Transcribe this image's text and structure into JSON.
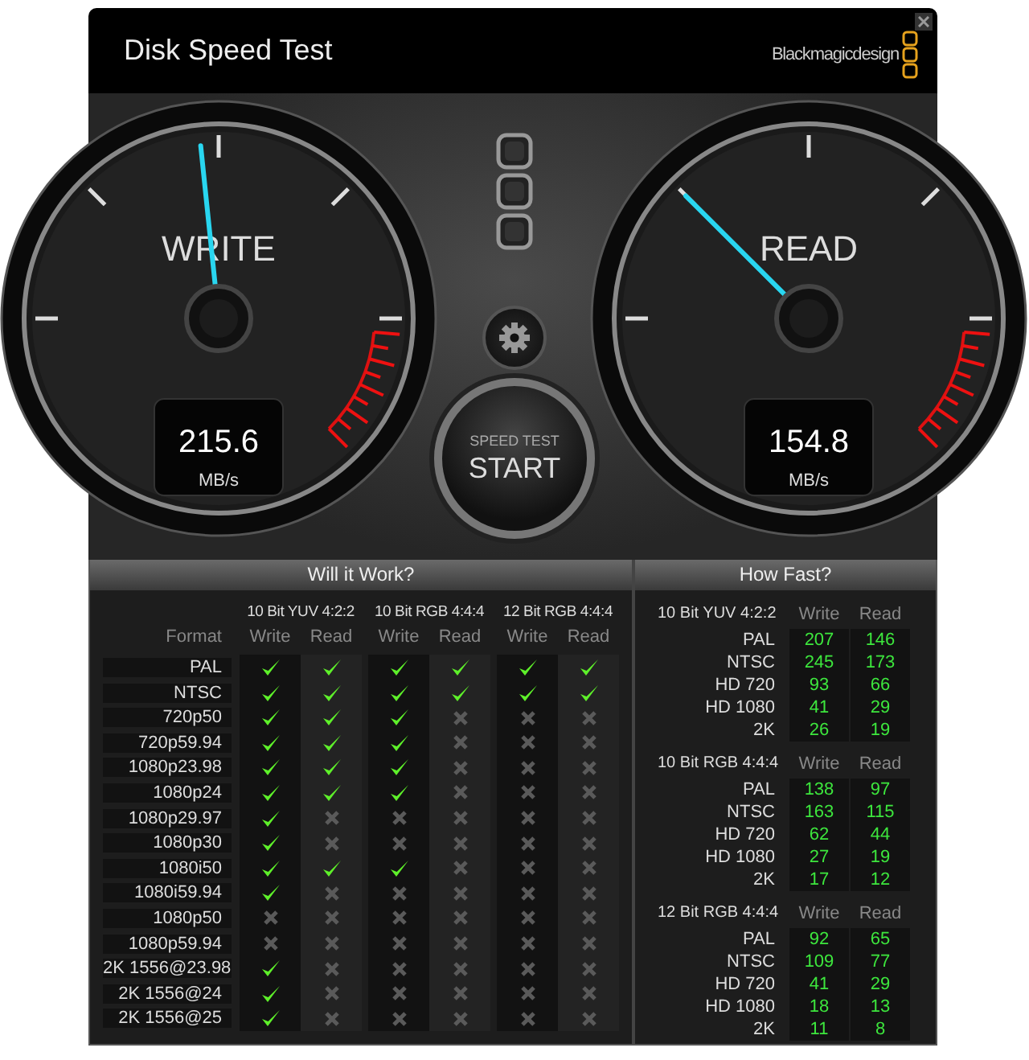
{
  "window": {
    "title": "Disk Speed Test",
    "brand": "Blackmagicdesign"
  },
  "gauges": [
    {
      "label": "WRITE",
      "reading": "215.6",
      "unit": "MB/s",
      "level": 0.478
    },
    {
      "label": "READ",
      "reading": "154.8",
      "unit": "MB/s",
      "level": 0.333
    }
  ],
  "start_button": {
    "caption": "SPEED TEST",
    "label": "START"
  },
  "will_it_work": {
    "title": "Will it Work?",
    "format_header": "Format",
    "groups": [
      {
        "name": "10 Bit YUV 4:2:2",
        "columns": [
          "Write",
          "Read"
        ]
      },
      {
        "name": "10 Bit RGB 4:4:4",
        "columns": [
          "Write",
          "Read"
        ]
      },
      {
        "name": "12 Bit RGB 4:4:4",
        "columns": [
          "Write",
          "Read"
        ]
      }
    ],
    "rows": [
      {
        "format": "PAL",
        "results": [
          {
            "works": true
          },
          {
            "works": true
          },
          {
            "works": true
          },
          {
            "works": true
          },
          {
            "works": true
          },
          {
            "works": true
          }
        ]
      },
      {
        "format": "NTSC",
        "results": [
          {
            "works": true
          },
          {
            "works": true
          },
          {
            "works": true
          },
          {
            "works": true
          },
          {
            "works": true
          },
          {
            "works": true
          }
        ]
      },
      {
        "format": "720p50",
        "results": [
          {
            "works": true
          },
          {
            "works": true
          },
          {
            "works": true
          },
          {
            "works": false
          },
          {
            "works": false
          },
          {
            "works": false
          }
        ]
      },
      {
        "format": "720p59.94",
        "results": [
          {
            "works": true
          },
          {
            "works": true
          },
          {
            "works": true
          },
          {
            "works": false
          },
          {
            "works": false
          },
          {
            "works": false
          }
        ]
      },
      {
        "format": "1080p23.98",
        "results": [
          {
            "works": true
          },
          {
            "works": true
          },
          {
            "works": true
          },
          {
            "works": false
          },
          {
            "works": false
          },
          {
            "works": false
          }
        ]
      },
      {
        "format": "1080p24",
        "results": [
          {
            "works": true
          },
          {
            "works": true
          },
          {
            "works": true
          },
          {
            "works": false
          },
          {
            "works": false
          },
          {
            "works": false
          }
        ]
      },
      {
        "format": "1080p29.97",
        "results": [
          {
            "works": true
          },
          {
            "works": false
          },
          {
            "works": false
          },
          {
            "works": false
          },
          {
            "works": false
          },
          {
            "works": false
          }
        ]
      },
      {
        "format": "1080p30",
        "results": [
          {
            "works": true
          },
          {
            "works": false
          },
          {
            "works": false
          },
          {
            "works": false
          },
          {
            "works": false
          },
          {
            "works": false
          }
        ]
      },
      {
        "format": "1080i50",
        "results": [
          {
            "works": true
          },
          {
            "works": true
          },
          {
            "works": true
          },
          {
            "works": false
          },
          {
            "works": false
          },
          {
            "works": false
          }
        ]
      },
      {
        "format": "1080i59.94",
        "results": [
          {
            "works": true
          },
          {
            "works": false
          },
          {
            "works": false
          },
          {
            "works": false
          },
          {
            "works": false
          },
          {
            "works": false
          }
        ]
      },
      {
        "format": "1080p50",
        "results": [
          {
            "works": false
          },
          {
            "works": false
          },
          {
            "works": false
          },
          {
            "works": false
          },
          {
            "works": false
          },
          {
            "works": false
          }
        ]
      },
      {
        "format": "1080p59.94",
        "results": [
          {
            "works": false
          },
          {
            "works": false
          },
          {
            "works": false
          },
          {
            "works": false
          },
          {
            "works": false
          },
          {
            "works": false
          }
        ]
      },
      {
        "format": "2K 1556@23.98",
        "results": [
          {
            "works": true
          },
          {
            "works": false
          },
          {
            "works": false
          },
          {
            "works": false
          },
          {
            "works": false
          },
          {
            "works": false
          }
        ]
      },
      {
        "format": "2K 1556@24",
        "results": [
          {
            "works": true
          },
          {
            "works": false
          },
          {
            "works": false
          },
          {
            "works": false
          },
          {
            "works": false
          },
          {
            "works": false
          }
        ]
      },
      {
        "format": "2K 1556@25",
        "results": [
          {
            "works": true
          },
          {
            "works": false
          },
          {
            "works": false
          },
          {
            "works": false
          },
          {
            "works": false
          },
          {
            "works": false
          }
        ]
      }
    ]
  },
  "how_fast": {
    "title": "How Fast?",
    "sections": [
      {
        "name": "10 Bit YUV 4:2:2",
        "columns": [
          "Write",
          "Read"
        ],
        "rows": [
          {
            "format": "PAL",
            "write": "207",
            "read": "146"
          },
          {
            "format": "NTSC",
            "write": "245",
            "read": "173"
          },
          {
            "format": "HD 720",
            "write": "93",
            "read": "66"
          },
          {
            "format": "HD 1080",
            "write": "41",
            "read": "29"
          },
          {
            "format": "2K",
            "write": "26",
            "read": "19"
          }
        ]
      },
      {
        "name": "10 Bit RGB 4:4:4",
        "columns": [
          "Write",
          "Read"
        ],
        "rows": [
          {
            "format": "PAL",
            "write": "138",
            "read": "97"
          },
          {
            "format": "NTSC",
            "write": "163",
            "read": "115"
          },
          {
            "format": "HD 720",
            "write": "62",
            "read": "44"
          },
          {
            "format": "HD 1080",
            "write": "27",
            "read": "19"
          },
          {
            "format": "2K",
            "write": "17",
            "read": "12"
          }
        ]
      },
      {
        "name": "12 Bit RGB 4:4:4",
        "columns": [
          "Write",
          "Read"
        ],
        "rows": [
          {
            "format": "PAL",
            "write": "92",
            "read": "65"
          },
          {
            "format": "NTSC",
            "write": "109",
            "read": "77"
          },
          {
            "format": "HD 720",
            "write": "41",
            "read": "29"
          },
          {
            "format": "HD 1080",
            "write": "18",
            "read": "13"
          },
          {
            "format": "2K",
            "write": "11",
            "read": "8"
          }
        ]
      }
    ]
  }
}
